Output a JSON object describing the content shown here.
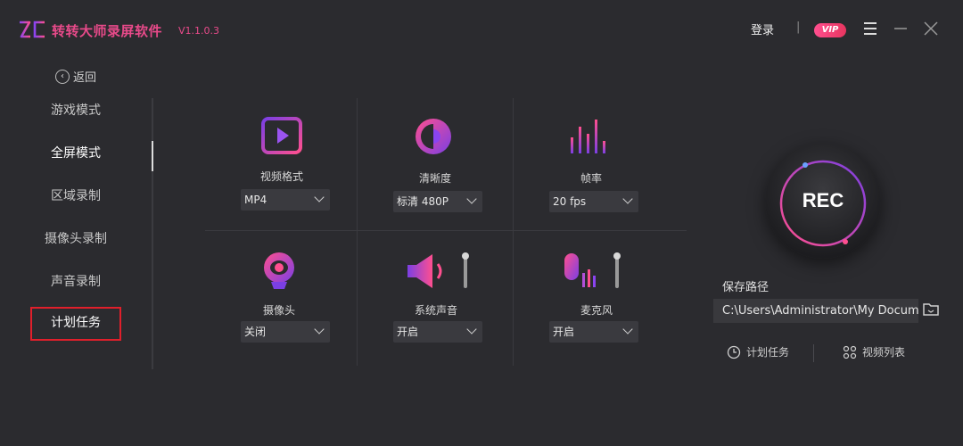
{
  "app": {
    "title": "转转大师录屏软件",
    "version": "V1.1.0.3",
    "login": "登录",
    "separator": "|",
    "vip": "VIP"
  },
  "sidebar": {
    "back": "返回",
    "items": [
      {
        "label": "游戏模式"
      },
      {
        "label": "全屏模式"
      },
      {
        "label": "区域录制"
      },
      {
        "label": "摄像头录制"
      },
      {
        "label": "声音录制"
      },
      {
        "label": "计划任务"
      }
    ]
  },
  "settings": {
    "video_format": {
      "label": "视频格式",
      "value": "MP4"
    },
    "quality": {
      "label": "清晰度",
      "value": "标清 480P"
    },
    "frame_rate": {
      "label": "帧率",
      "value": "20 fps"
    },
    "camera": {
      "label": "摄像头",
      "value": "关闭"
    },
    "system_audio": {
      "label": "系统声音",
      "value": "开启"
    },
    "microphone": {
      "label": "麦克风",
      "value": "开启"
    }
  },
  "rec": {
    "label": "REC",
    "save_path_label": "保存路径",
    "save_path": "C:\\Users\\Administrator\\My Documents",
    "schedule": "计划任务",
    "video_list": "视频列表"
  },
  "colors": {
    "accent": "#e84a8a",
    "purple": "#7b3fe4",
    "highlight_border": "#e01f2b",
    "background": "#2b2b2f"
  }
}
